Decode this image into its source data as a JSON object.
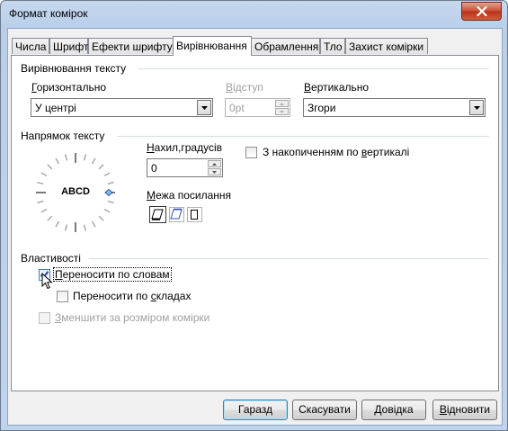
{
  "window": {
    "title": "Формат комірок"
  },
  "tabs": [
    {
      "label": "Числа"
    },
    {
      "label": "Шрифт"
    },
    {
      "label": "Ефекти шрифту"
    },
    {
      "label": "Вирівнювання"
    },
    {
      "label": "Обрамлення"
    },
    {
      "label": "Тло"
    },
    {
      "label": "Захист комірки"
    }
  ],
  "active_tab": "Вирівнювання",
  "text_alignment": {
    "heading": "Вирівнювання тексту",
    "horizontal_label": "Горизонтально",
    "horizontal_value": "У центрі",
    "indent_label": "Відступ",
    "indent_value": "0pt",
    "vertical_label": "Вертикально",
    "vertical_value": "Згори"
  },
  "text_orientation": {
    "heading": "Напрямок тексту",
    "dial_text": "ABCD",
    "stacked_label": "З накопиченням по вертикалі",
    "stacked_checked": false,
    "angle_label": "Нахил,градусів",
    "angle_value": "0",
    "reference_edge_label": "Межа посилання"
  },
  "properties": {
    "heading": "Властивості",
    "wrap_label": "Переносити по словам",
    "wrap_checked": true,
    "hyphenation_label": "Переносити по складах",
    "hyphenation_checked": false,
    "shrink_label": "Зменшити за розміром комірки",
    "shrink_checked": false
  },
  "buttons": {
    "ok": "Гаразд",
    "cancel": "Скасувати",
    "help": "Довідка",
    "reset": "Відновити"
  },
  "colors": {
    "accent_check": "#1c4bb2",
    "disabled_text": "#a0a0a0"
  }
}
